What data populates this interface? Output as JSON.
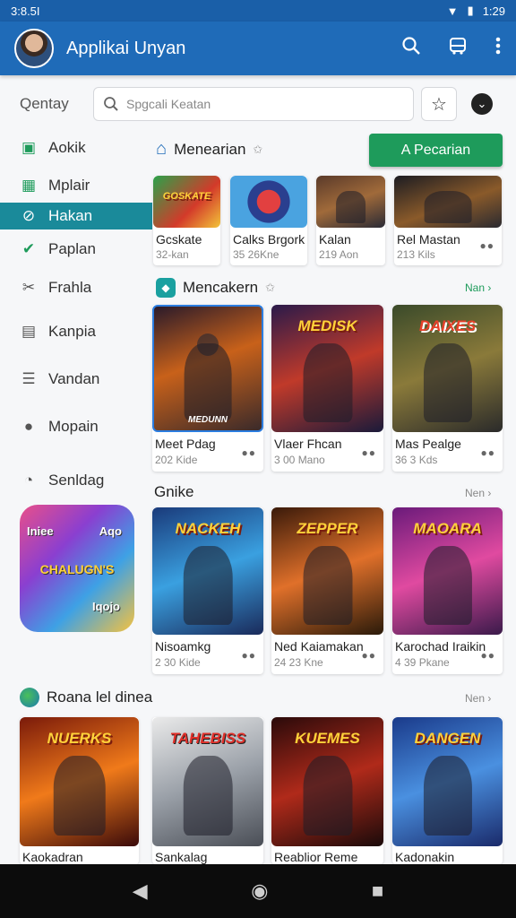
{
  "status": {
    "time": "3:8.5I",
    "right_time": "1:29"
  },
  "appbar": {
    "title": "Applikai Unyan"
  },
  "search": {
    "label": "Qentay",
    "placeholder": "Spgcali Keatan"
  },
  "sidebar": {
    "items": [
      {
        "label": "Aokik",
        "icon": "briefcase-icon"
      },
      {
        "label": "Mplair",
        "icon": "grid-icon"
      },
      {
        "label": "Hakan",
        "icon": "link-icon",
        "active": true
      },
      {
        "label": "Paplan",
        "icon": "check-icon"
      },
      {
        "label": "Frahla",
        "icon": "tools-icon"
      },
      {
        "label": "Kanpia",
        "icon": "bag-icon"
      },
      {
        "label": "Vandan",
        "icon": "list-icon"
      },
      {
        "label": "Mopain",
        "icon": "alert-icon"
      },
      {
        "label": "Senldag",
        "icon": "clock-icon"
      }
    ],
    "promo": {
      "top": "Iniee",
      "top_right": "Aqo",
      "middle": "CHALUGN'S",
      "bottom": "Iqojo"
    }
  },
  "sections": {
    "s1": {
      "title": "Menearian",
      "button": "A Pecarian"
    },
    "s2": {
      "title": "Mencakern",
      "more": "Nan ›"
    },
    "s3": {
      "title": "Gnike",
      "more": "Nen ›"
    },
    "s4": {
      "title": "Roana lel dinea",
      "more": "Nen ›"
    }
  },
  "row1": [
    {
      "name": "Gcskate",
      "meta": "32-kan"
    },
    {
      "name": "Calks Brgork",
      "meta": "35 26Kne"
    },
    {
      "name": "Kalan",
      "meta": "219 Aon"
    },
    {
      "name": "Rel Mastan",
      "meta": "213 Kils"
    }
  ],
  "row2": [
    {
      "name": "Meet Pdag",
      "meta": "202 Kide",
      "logo": "MEDUNN"
    },
    {
      "name": "Vlaer Fhcan",
      "meta": "3 00 Mano",
      "logo": "MEDISK"
    },
    {
      "name": "Mas Pealge",
      "meta": "36 3 Kds",
      "logo": "DAIXES"
    }
  ],
  "row3": [
    {
      "name": "Nisoamkg",
      "meta": "2 30 Kide",
      "logo": "NACKEH"
    },
    {
      "name": "Ned Kaiamakan",
      "meta": "24 23 Kne",
      "logo": "ZEPPER"
    },
    {
      "name": "Karochad Iraikin",
      "meta": "4 39 Pkane",
      "logo": "MAOARA"
    }
  ],
  "row4": [
    {
      "name": "Kaokadran",
      "logo": "NUERKS"
    },
    {
      "name": "Sankalag",
      "logo": "TAHEBISS"
    },
    {
      "name": "Reablior Reme",
      "logo": "KUEMES"
    },
    {
      "name": "Kadonakin",
      "logo": "DANGEN"
    }
  ],
  "colors": {
    "appbar": "#1f6bb8",
    "active": "#1a8a9a",
    "green_button": "#1e9b5b"
  }
}
